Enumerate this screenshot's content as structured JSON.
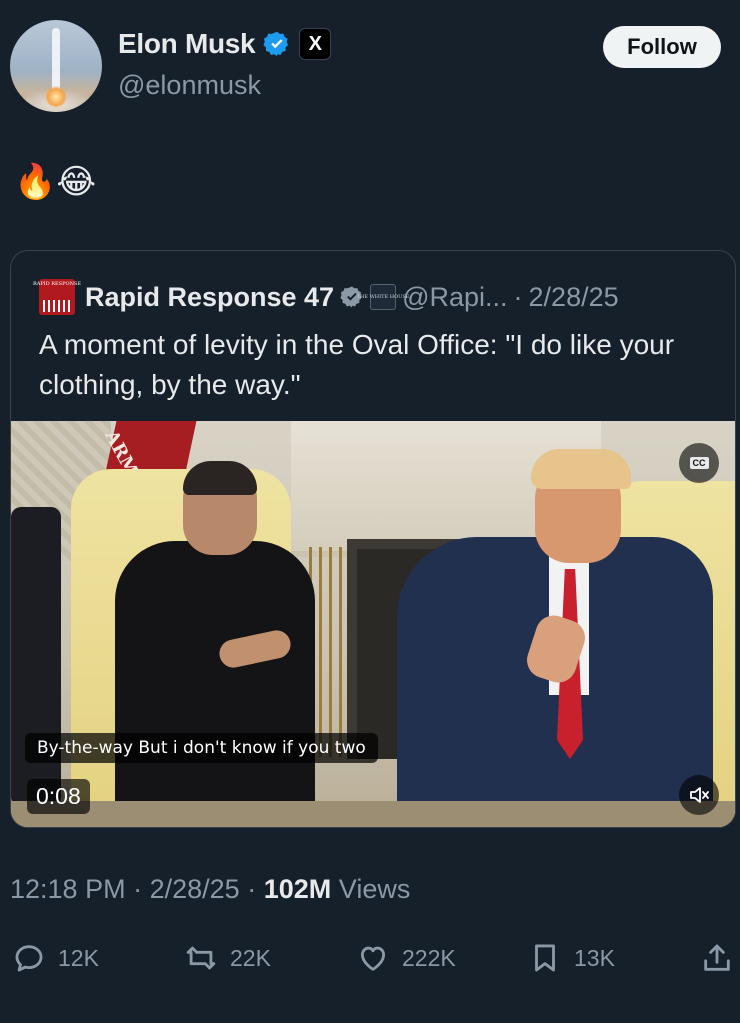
{
  "author": {
    "name": "Elon Musk",
    "handle": "@elonmusk",
    "affiliate_badge": "X",
    "verified": true
  },
  "follow_label": "Follow",
  "post_text": "🔥😂",
  "quoted": {
    "name": "Rapid Response 47",
    "avatar_text": "RAPID RESPONSE",
    "affiliate_text": "THE WHITE HOUSE",
    "handle": "@Rapi...",
    "dot": "·",
    "date": "2/28/25",
    "text": "A moment of levity in the Oval Office: \"I do like your clothing, by the way.\"",
    "video": {
      "flag_text": "ARM",
      "cc_label": "CC",
      "caption": "By-the-way But i don't know if you two",
      "timestamp": "0:08",
      "muted": true
    }
  },
  "meta": {
    "time": "12:18 PM",
    "sep1": "·",
    "date": "2/28/25",
    "sep2": "·",
    "views": "102M",
    "views_label": "Views"
  },
  "actions": {
    "replies": "12K",
    "reposts": "22K",
    "likes": "222K",
    "bookmarks": "13K"
  },
  "colors": {
    "background": "#15202b",
    "verified_blue": "#1d9bf0",
    "muted_text": "#8b98a5"
  },
  "icons": [
    "reply-icon",
    "repost-icon",
    "like-icon",
    "bookmark-icon",
    "share-icon",
    "verified-icon",
    "cc-icon",
    "mute-icon"
  ]
}
